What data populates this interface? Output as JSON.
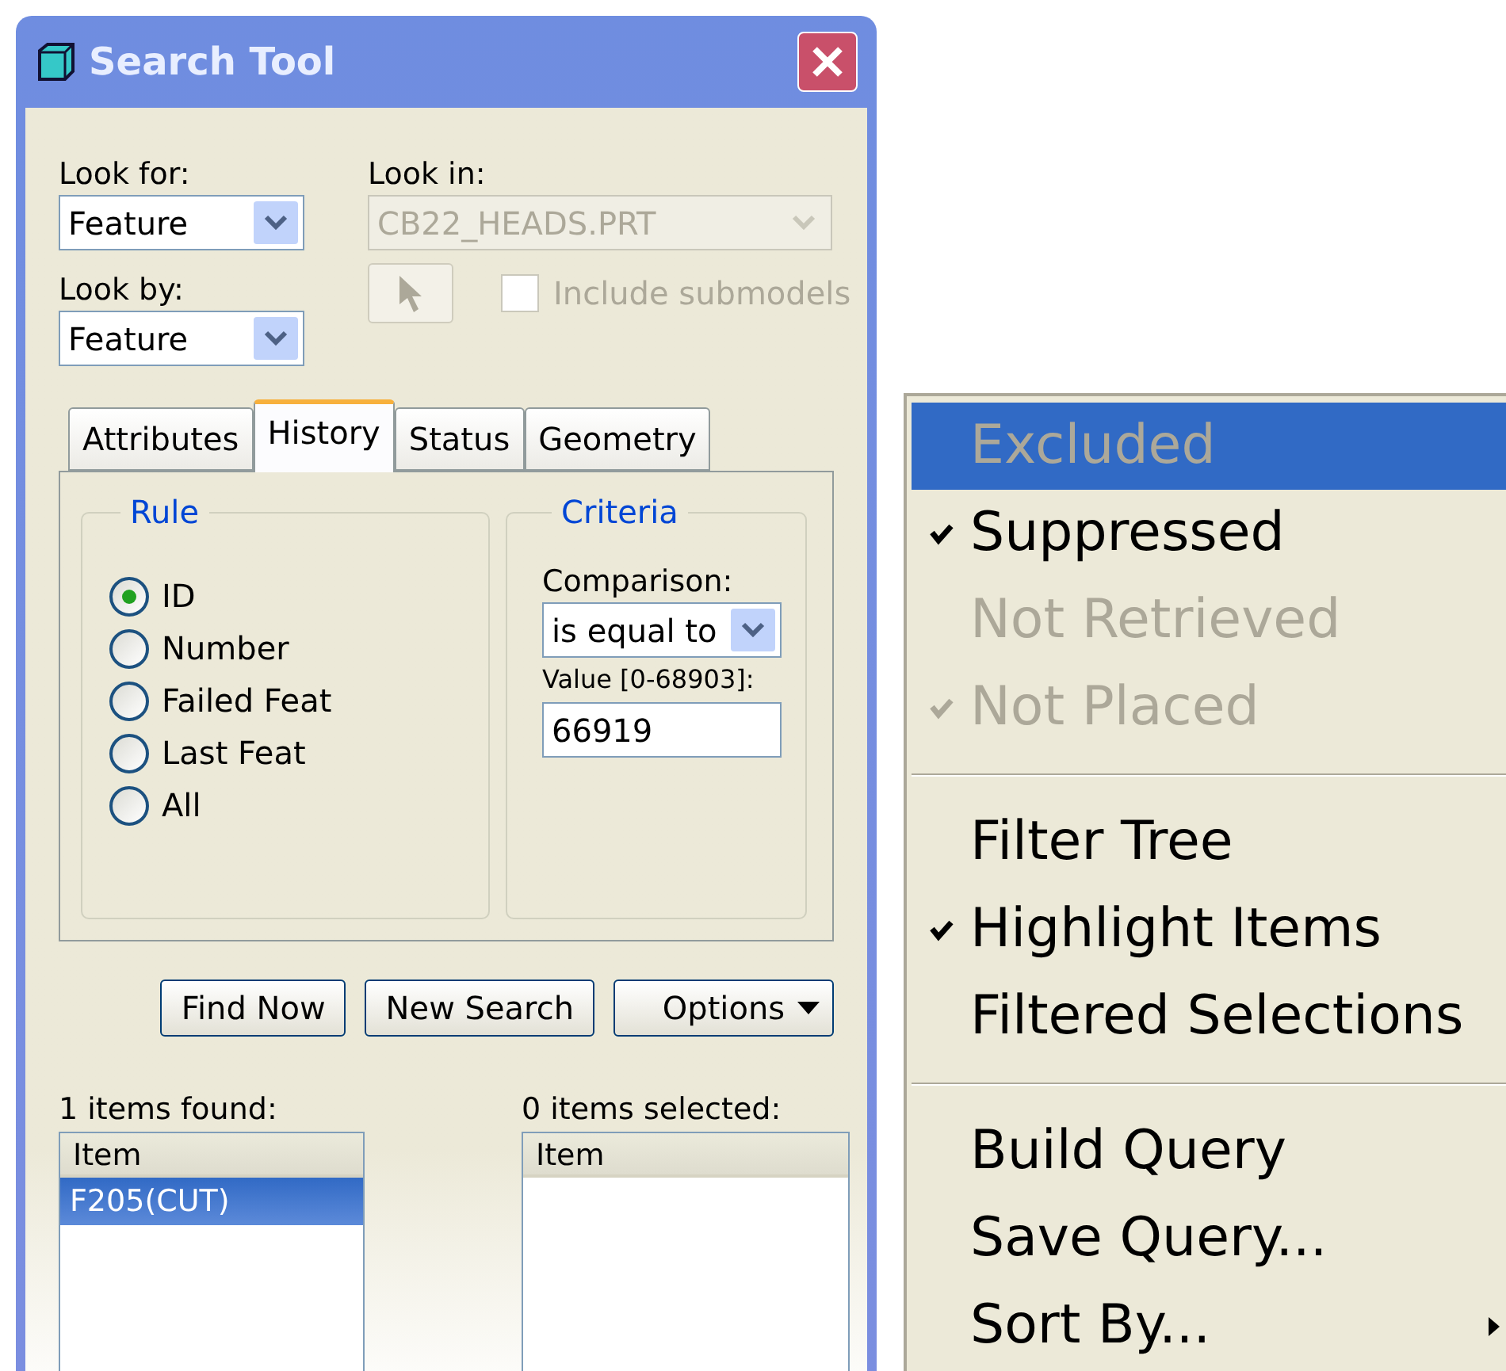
{
  "window": {
    "title": "Search Tool"
  },
  "look_for": {
    "label": "Look for:",
    "value": "Feature"
  },
  "look_in": {
    "label": "Look in:",
    "value": "CB22_HEADS.PRT",
    "disabled": true
  },
  "include_submodels": {
    "label": "Include submodels",
    "checked": false,
    "disabled": true
  },
  "look_by": {
    "label": "Look by:",
    "value": "Feature"
  },
  "tabs": [
    {
      "label": "Attributes",
      "selected": false
    },
    {
      "label": "History",
      "selected": true
    },
    {
      "label": "Status",
      "selected": false
    },
    {
      "label": "Geometry",
      "selected": false
    }
  ],
  "rule": {
    "title": "Rule",
    "options": [
      {
        "label": "ID",
        "selected": true
      },
      {
        "label": "Number",
        "selected": false
      },
      {
        "label": "Failed Feat",
        "selected": false
      },
      {
        "label": "Last Feat",
        "selected": false
      },
      {
        "label": "All",
        "selected": false
      }
    ]
  },
  "criteria": {
    "title": "Criteria",
    "comparison_label": "Comparison:",
    "comparison": "is equal to",
    "value_label": "Value [0-68903]:",
    "value": "66919"
  },
  "buttons": [
    {
      "label": "Find Now",
      "kind": "plain"
    },
    {
      "label": "New Search",
      "kind": "plain"
    },
    {
      "label": "Options",
      "kind": "dropdown"
    }
  ],
  "found": {
    "label": "1 items found:",
    "column": "Item",
    "rows": [
      {
        "text": "F205(CUT)",
        "selected": true
      }
    ]
  },
  "selected_list": {
    "label": "0 items selected:",
    "column": "Item"
  },
  "menu": [
    {
      "kind": "item",
      "label": "Excluded",
      "checked": false,
      "disabled": true,
      "selected": true
    },
    {
      "kind": "item",
      "label": "Suppressed",
      "checked": true,
      "disabled": false,
      "selected": false
    },
    {
      "kind": "item",
      "label": "Not Retrieved",
      "checked": false,
      "disabled": true,
      "selected": false
    },
    {
      "kind": "item",
      "label": "Not Placed",
      "checked": true,
      "disabled": true,
      "selected": false
    },
    {
      "kind": "separator"
    },
    {
      "kind": "item",
      "label": "Filter Tree",
      "checked": false,
      "disabled": false,
      "selected": false
    },
    {
      "kind": "item",
      "label": "Highlight Items",
      "checked": true,
      "disabled": false,
      "selected": false
    },
    {
      "kind": "item",
      "label": "Filtered Selections",
      "checked": false,
      "disabled": false,
      "selected": false
    },
    {
      "kind": "separator"
    },
    {
      "kind": "item",
      "label": "Build Query",
      "checked": false,
      "disabled": false,
      "selected": false
    },
    {
      "kind": "item",
      "label": "Save Query...",
      "checked": false,
      "disabled": false,
      "selected": false
    },
    {
      "kind": "submenu",
      "label": "Sort By...",
      "checked": false,
      "disabled": false,
      "selected": false
    }
  ]
}
